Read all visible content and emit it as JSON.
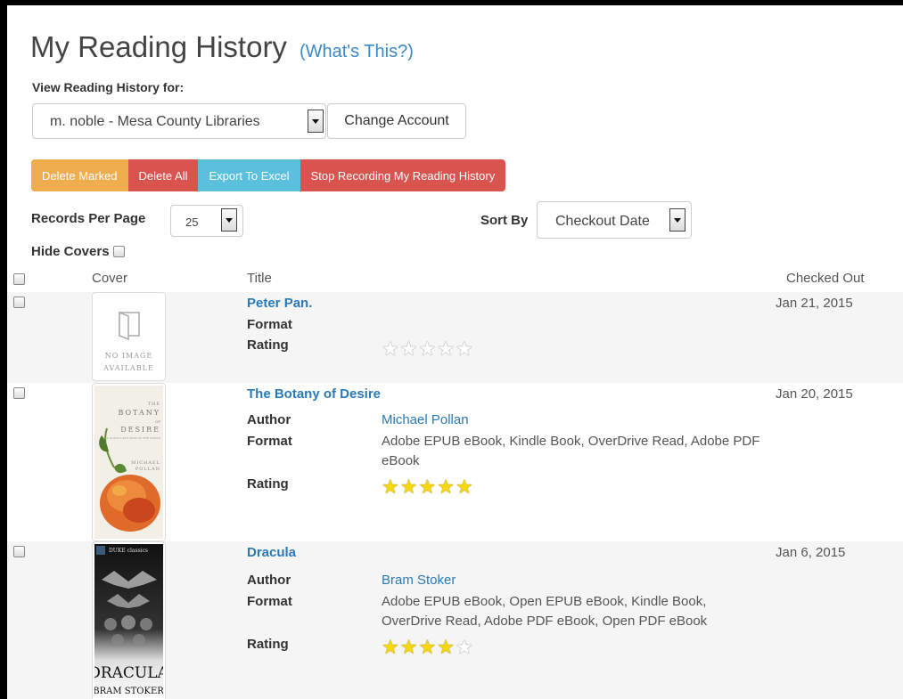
{
  "header": {
    "title": "My Reading History",
    "whats_this": "(What's This?)"
  },
  "account": {
    "label": "View Reading History for:",
    "selected": "m. noble - Mesa County Libraries",
    "change_button": "Change Account"
  },
  "actions": {
    "delete_marked": "Delete Marked",
    "delete_all": "Delete All",
    "export": "Export To Excel",
    "stop_recording": "Stop Recording My Reading History"
  },
  "controls": {
    "records_per_page_label": "Records Per Page",
    "records_per_page_value": "25",
    "sort_by_label": "Sort By",
    "sort_by_value": "Checkout Date",
    "hide_covers_label": "Hide Covers"
  },
  "table": {
    "headers": {
      "cover": "Cover",
      "title": "Title",
      "checked_out": "Checked Out"
    },
    "labels": {
      "author": "Author",
      "format": "Format",
      "rating": "Rating"
    },
    "no_image_line1": "NO IMAGE",
    "no_image_line2": "AVAILABLE",
    "rows": [
      {
        "title": "Peter Pan.",
        "author": "",
        "format": "",
        "rating": 0,
        "checked_out": "Jan 21, 2015"
      },
      {
        "title": "The Botany of Desire",
        "author": "Michael Pollan",
        "format": "Adobe EPUB eBook, Kindle Book, OverDrive Read, Adobe PDF eBook",
        "rating": 5,
        "checked_out": "Jan 20, 2015",
        "cover_text": {
          "l1": "THE",
          "l2": "BOTANY",
          "l3": "OF",
          "l4": "DESIRE",
          "l5": "A PLANT'S-EYE VIEW OF THE WORLD",
          "l6": "MICHAEL",
          "l7": "POLLAN"
        }
      },
      {
        "title": "Dracula",
        "author": "Bram Stoker",
        "format": "Adobe EPUB eBook, Open EPUB eBook, Kindle Book, OverDrive Read, Adobe PDF eBook, Open PDF eBook",
        "rating": 4,
        "checked_out": "Jan 6, 2015",
        "cover_text": {
          "series": "DUKE classics",
          "t1": "DRACULA",
          "t2": "BRAM STOKER"
        }
      }
    ]
  },
  "colors": {
    "link": "#2a7ab8",
    "warning": "#f0ad4e",
    "danger": "#d9534f",
    "info": "#5bc0de",
    "star": "#f5d90e"
  }
}
